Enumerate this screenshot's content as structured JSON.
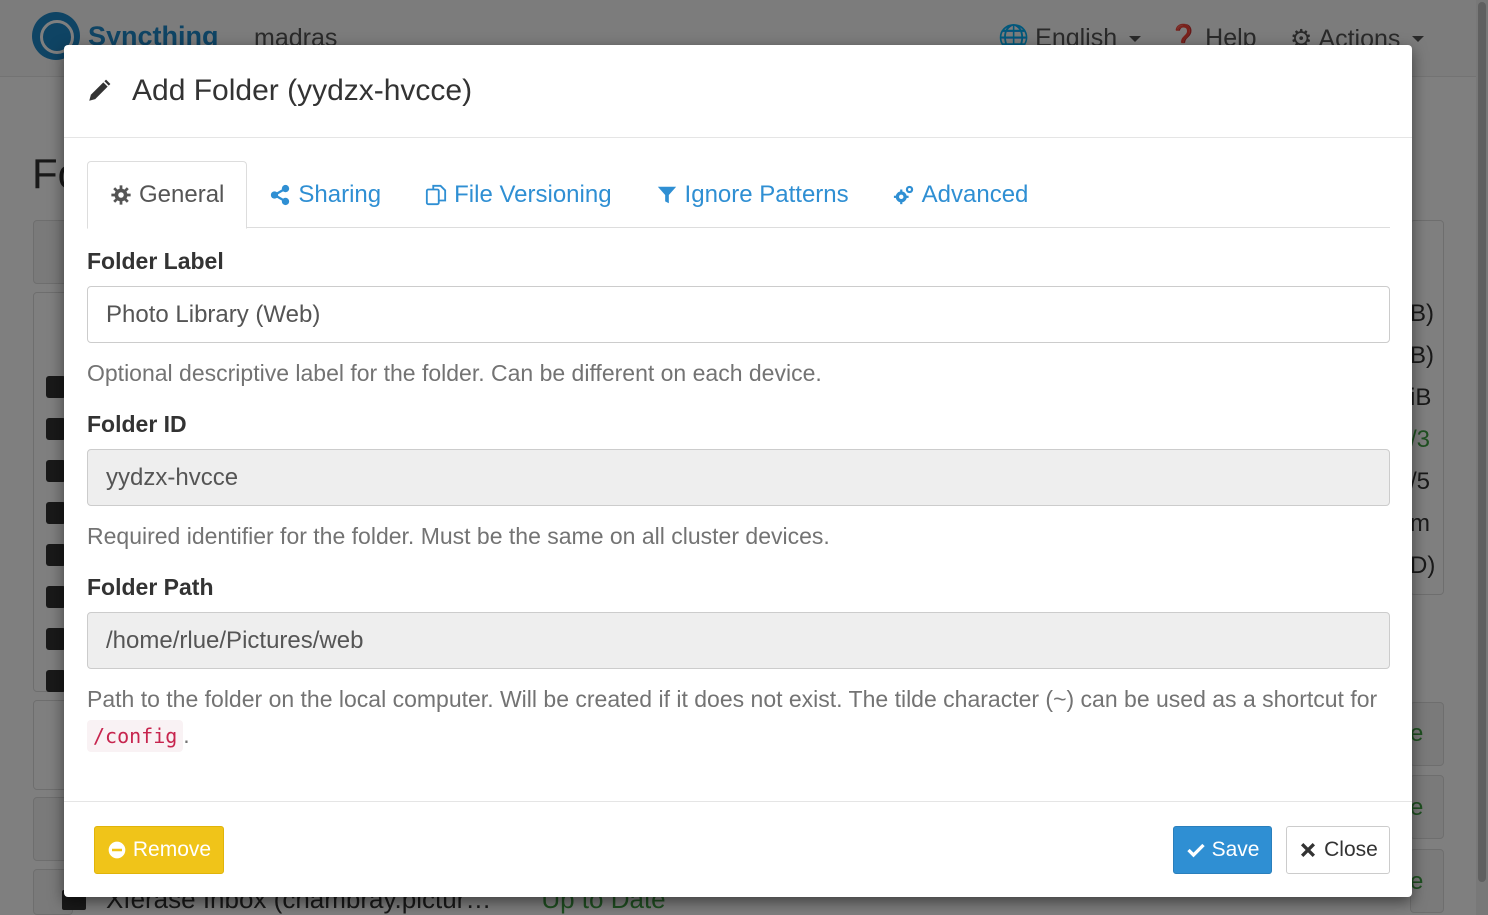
{
  "navbar": {
    "brand": "Syncthing",
    "device_name": "madras",
    "language": "English",
    "help": "Help",
    "actions": "Actions"
  },
  "background": {
    "heading": "Fo",
    "right_fragments": [
      "B)",
      "B)",
      "iB",
      "/3",
      "/5",
      "m",
      "D)",
      "e",
      "e",
      "e"
    ],
    "bottom_row": {
      "folder": "Xferase Inbox (chambray.pictur…",
      "status": "Up to Date"
    }
  },
  "modal": {
    "title": "Add Folder (yydzx-hvcce)",
    "tabs": [
      {
        "label": "General",
        "icon": "gear-icon",
        "active": true
      },
      {
        "label": "Sharing",
        "icon": "share-icon",
        "active": false
      },
      {
        "label": "File Versioning",
        "icon": "copy-icon",
        "active": false
      },
      {
        "label": "Ignore Patterns",
        "icon": "filter-icon",
        "active": false
      },
      {
        "label": "Advanced",
        "icon": "gears-icon",
        "active": false
      }
    ],
    "fields": {
      "folder_label": {
        "label": "Folder Label",
        "value": "Photo Library (Web)",
        "help": "Optional descriptive label for the folder. Can be different on each device."
      },
      "folder_id": {
        "label": "Folder ID",
        "value": "yydzx-hvcce",
        "help": "Required identifier for the folder. Must be the same on all cluster devices."
      },
      "folder_path": {
        "label": "Folder Path",
        "value": "/home/rlue/Pictures/web",
        "help_before": "Path to the folder on the local computer. Will be created if it does not exist. The tilde character (~) can be used as a shortcut for",
        "help_code": "/config",
        "help_after": "."
      }
    },
    "buttons": {
      "remove": "Remove",
      "save": "Save",
      "close": "Close"
    }
  },
  "colors": {
    "link": "#2f8fd3",
    "warning": "#f0c419",
    "primary": "#2f8fd3",
    "success": "#3fa142"
  }
}
